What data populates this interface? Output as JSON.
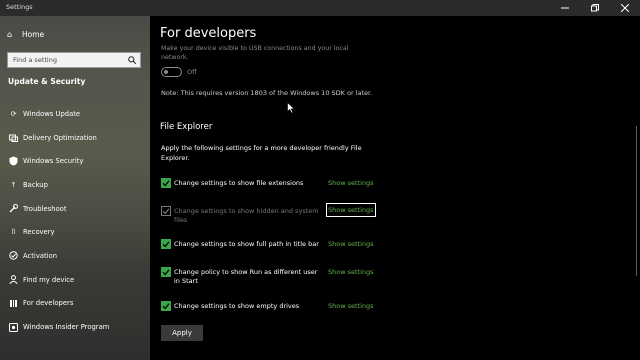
{
  "window": {
    "title": "Settings"
  },
  "sidebar": {
    "home_label": "Home",
    "search_placeholder": "Find a setting",
    "section_title": "Update & Security",
    "items": [
      {
        "label": "Windows Update",
        "icon": "sync-icon"
      },
      {
        "label": "Delivery Optimization",
        "icon": "delivery-icon"
      },
      {
        "label": "Windows Security",
        "icon": "shield-icon"
      },
      {
        "label": "Backup",
        "icon": "backup-icon"
      },
      {
        "label": "Troubleshoot",
        "icon": "wrench-icon"
      },
      {
        "label": "Recovery",
        "icon": "recovery-icon"
      },
      {
        "label": "Activation",
        "icon": "activation-icon"
      },
      {
        "label": "Find my device",
        "icon": "person-icon"
      },
      {
        "label": "For developers",
        "icon": "developer-icon"
      },
      {
        "label": "Windows Insider Program",
        "icon": "insider-icon"
      }
    ]
  },
  "main": {
    "title": "For developers",
    "faded_text": "Make your device visible to USB connections and your local network.",
    "toggle_label": "Off",
    "note": "Note: This requires version 1803 of the Windows 10 SDK or later.",
    "file_explorer": {
      "heading": "File Explorer",
      "description": "Apply the following settings for a more developer friendly File Explorer.",
      "rows": [
        {
          "label": "Change settings to show file extensions",
          "link": "Show settings",
          "checked": true,
          "enabled": true
        },
        {
          "label": "Change settings to show hidden and system files",
          "link": "Show settings",
          "checked": true,
          "enabled": false
        },
        {
          "label": "Change settings to show full path in title bar",
          "link": "Show settings",
          "checked": true,
          "enabled": true
        },
        {
          "label": "Change policy to show Run as different user in Start",
          "link": "Show settings",
          "checked": true,
          "enabled": true
        },
        {
          "label": "Change settings to show empty drives",
          "link": "Show settings",
          "checked": true,
          "enabled": true
        }
      ],
      "apply_label": "Apply"
    }
  },
  "colors": {
    "accent": "#3aa84a",
    "link": "#66b34f"
  }
}
